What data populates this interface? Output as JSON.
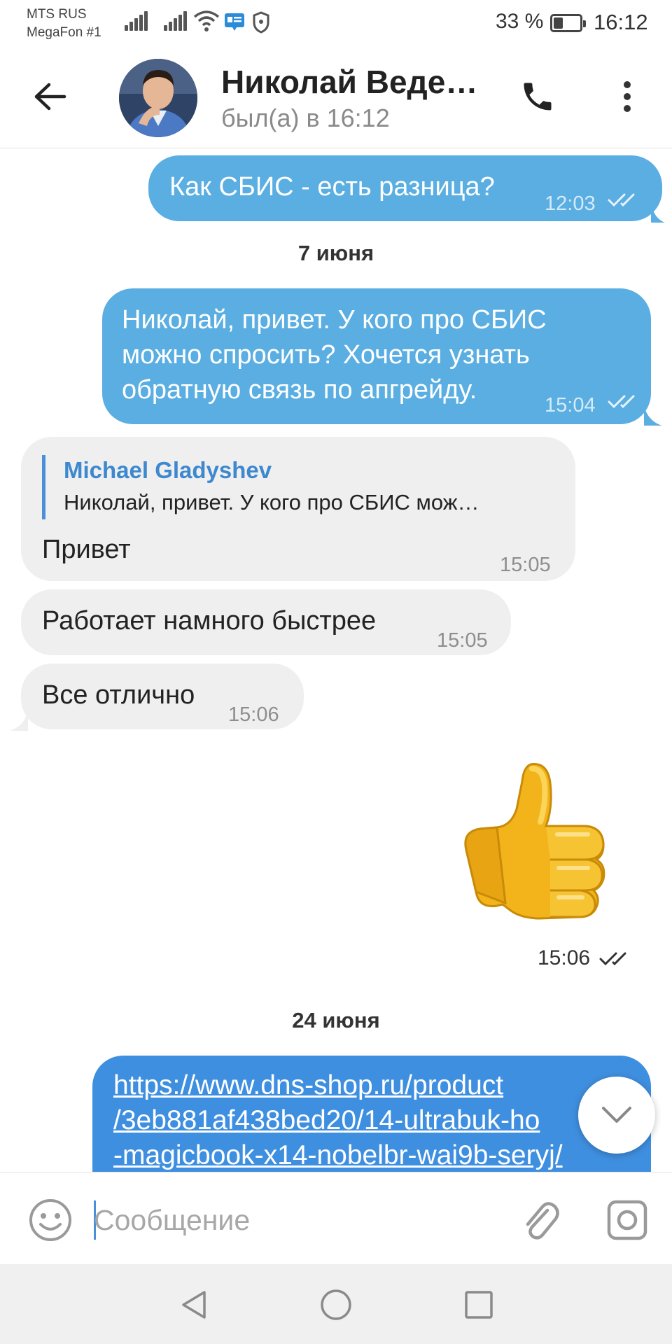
{
  "status_bar": {
    "carrier_1": "MTS RUS",
    "carrier_2": "MegaFon #1",
    "battery_text": "33 %",
    "battery_level": 0.33,
    "time": "16:12"
  },
  "header": {
    "contact_name": "Николай Веде…",
    "contact_status": "был(а) в 16:12"
  },
  "messages": [
    {
      "direction": "out",
      "text": "Как СБИС - есть разница?",
      "time": "12:03",
      "read": true
    },
    {
      "type": "date",
      "text": "7 июня"
    },
    {
      "direction": "out",
      "lines": [
        "Николай, привет. У кого про СБИС",
        "можно спросить? Хочется узнать",
        "обратную связь по апгрейду."
      ],
      "time": "15:04",
      "read": true
    },
    {
      "direction": "in",
      "reply_author": "Michael Gladyshev",
      "reply_text": "Николай, привет. У кого про СБИС мож…",
      "text": "Привет",
      "time": "15:05"
    },
    {
      "direction": "in",
      "text": "Работает намного быстрее",
      "time": "15:05"
    },
    {
      "direction": "in",
      "text": "Все отлично",
      "time": "15:06"
    },
    {
      "direction": "out",
      "sticker": "thumbs-up",
      "time": "15:06",
      "read": true
    },
    {
      "type": "date",
      "text": "24 июня"
    },
    {
      "direction": "out",
      "link_lines": [
        "https://www.dns-shop.ru/product",
        "/3eb881af438bed20/14-ultrabuk-ho",
        "-magicbook-x14-nobelbr-wai9b-seryj/"
      ]
    }
  ],
  "input": {
    "placeholder": "Сообщение"
  },
  "colors": {
    "outgoing_bubble": "#5aaee2",
    "incoming_bubble": "#efefef",
    "accent": "#3d88cf"
  }
}
